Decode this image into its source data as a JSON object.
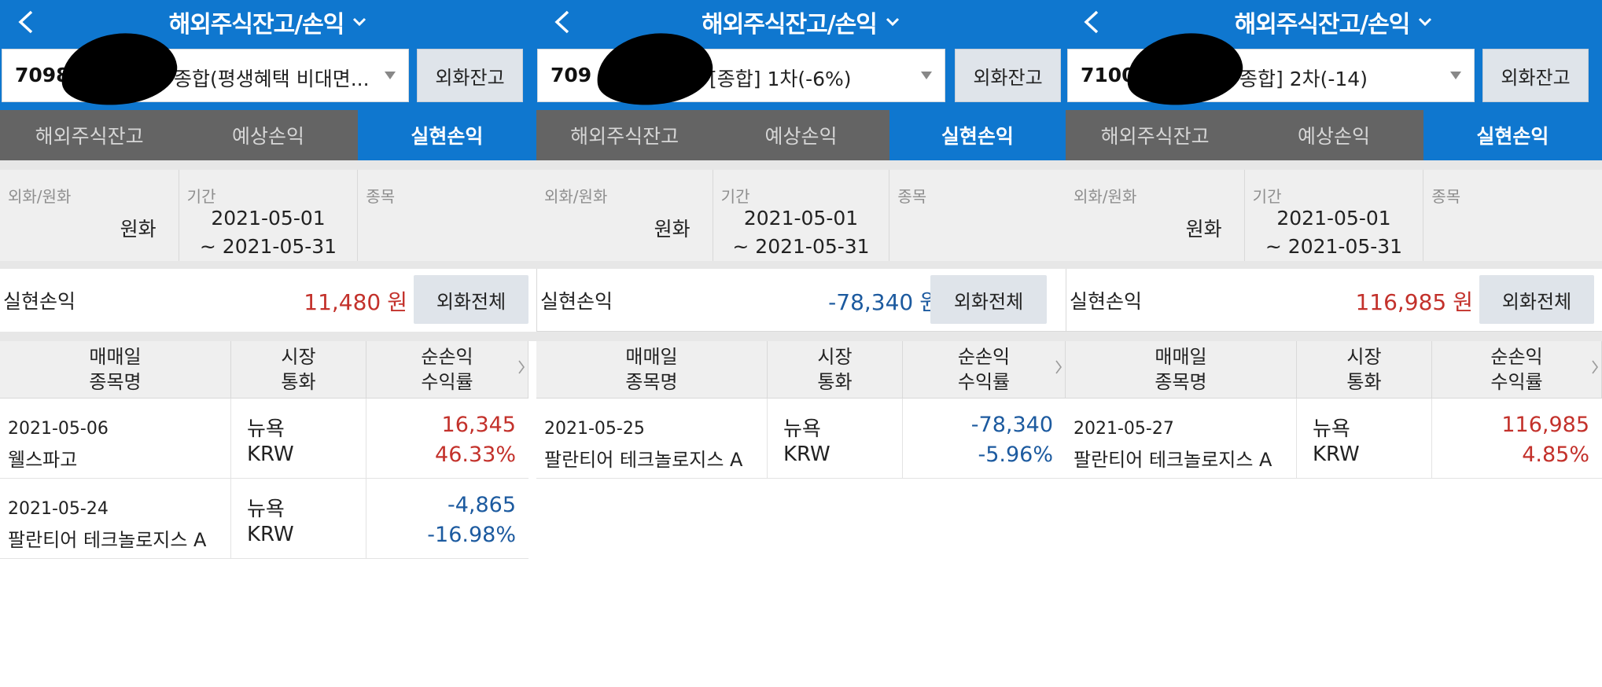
{
  "colors": {
    "header_blue": "#0f77cf",
    "tab_gray": "#646464",
    "profit_red": "#c3312b",
    "loss_blue": "#1c5a9f"
  },
  "icons": {
    "back": "chevron-left-icon",
    "title_toggle": "chevron-down-icon",
    "account_dropdown": "triangle-down-icon",
    "columns_more": "chevron-right-icon"
  },
  "panels": [
    {
      "header": {
        "title": "해외주식잔고/손익"
      },
      "account": {
        "number": "7098",
        "name": "종합(평생혜택 비대면...",
        "fx_balance_button": "외화잔고"
      },
      "tabs": [
        {
          "label": "해외주식잔고",
          "active": false
        },
        {
          "label": "예상손익",
          "active": false
        },
        {
          "label": "실현손익",
          "active": true
        }
      ],
      "filters": {
        "currency_label": "외화/원화",
        "currency_value": "원화",
        "period_label": "기간",
        "period_start": "2021-05-01",
        "period_end": "~ 2021-05-31",
        "stock_label": "종목"
      },
      "summary": {
        "label": "실현손익",
        "value": "11,480",
        "unit": "원",
        "sign": "positive",
        "fx_all_button": "외화전체"
      },
      "table": {
        "headers": [
          {
            "top": "매매일",
            "bottom": "종목명"
          },
          {
            "top": "시장",
            "bottom": "통화"
          },
          {
            "top": "순손익",
            "bottom": "수익률"
          }
        ],
        "rows": [
          {
            "date": "2021-05-06",
            "name": "웰스파고",
            "market": "뉴욕",
            "currency": "KRW",
            "net": "16,345",
            "yield": "46.33%",
            "sign": "positive"
          },
          {
            "date": "2021-05-24",
            "name": "팔란티어 테크놀로지스 A",
            "market": "뉴욕",
            "currency": "KRW",
            "net": "-4,865",
            "yield": "-16.98%",
            "sign": "negative"
          }
        ]
      }
    },
    {
      "header": {
        "title": "해외주식잔고/손익"
      },
      "account": {
        "number": "709",
        "name": "[종합]  1차(-6%)",
        "fx_balance_button": "외화잔고"
      },
      "tabs": [
        {
          "label": "해외주식잔고",
          "active": false
        },
        {
          "label": "예상손익",
          "active": false
        },
        {
          "label": "실현손익",
          "active": true
        }
      ],
      "filters": {
        "currency_label": "외화/원화",
        "currency_value": "원화",
        "period_label": "기간",
        "period_start": "2021-05-01",
        "period_end": "~ 2021-05-31",
        "stock_label": "종목"
      },
      "summary": {
        "label": "실현손익",
        "value": "-78,340",
        "unit": "원",
        "sign": "negative",
        "fx_all_button": "외화전체"
      },
      "table": {
        "headers": [
          {
            "top": "매매일",
            "bottom": "종목명"
          },
          {
            "top": "시장",
            "bottom": "통화"
          },
          {
            "top": "순손익",
            "bottom": "수익률"
          }
        ],
        "rows": [
          {
            "date": "2021-05-25",
            "name": "팔란티어 테크놀로지스 A",
            "market": "뉴욕",
            "currency": "KRW",
            "net": "-78,340",
            "yield": "-5.96%",
            "sign": "negative"
          }
        ]
      }
    },
    {
      "header": {
        "title": "해외주식잔고/손익"
      },
      "account": {
        "number": "7100",
        "name": "종합]  2차(-14)",
        "fx_balance_button": "외화잔고"
      },
      "tabs": [
        {
          "label": "해외주식잔고",
          "active": false
        },
        {
          "label": "예상손익",
          "active": false
        },
        {
          "label": "실현손익",
          "active": true
        }
      ],
      "filters": {
        "currency_label": "외화/원화",
        "currency_value": "원화",
        "period_label": "기간",
        "period_start": "2021-05-01",
        "period_end": "~ 2021-05-31",
        "stock_label": "종목"
      },
      "summary": {
        "label": "실현손익",
        "value": "116,985",
        "unit": "원",
        "sign": "positive",
        "fx_all_button": "외화전체"
      },
      "table": {
        "headers": [
          {
            "top": "매매일",
            "bottom": "종목명"
          },
          {
            "top": "시장",
            "bottom": "통화"
          },
          {
            "top": "순손익",
            "bottom": "수익률"
          }
        ],
        "rows": [
          {
            "date": "2021-05-27",
            "name": "팔란티어 테크놀로지스 A",
            "market": "뉴욕",
            "currency": "KRW",
            "net": "116,985",
            "yield": "4.85%",
            "sign": "positive"
          }
        ]
      }
    }
  ]
}
